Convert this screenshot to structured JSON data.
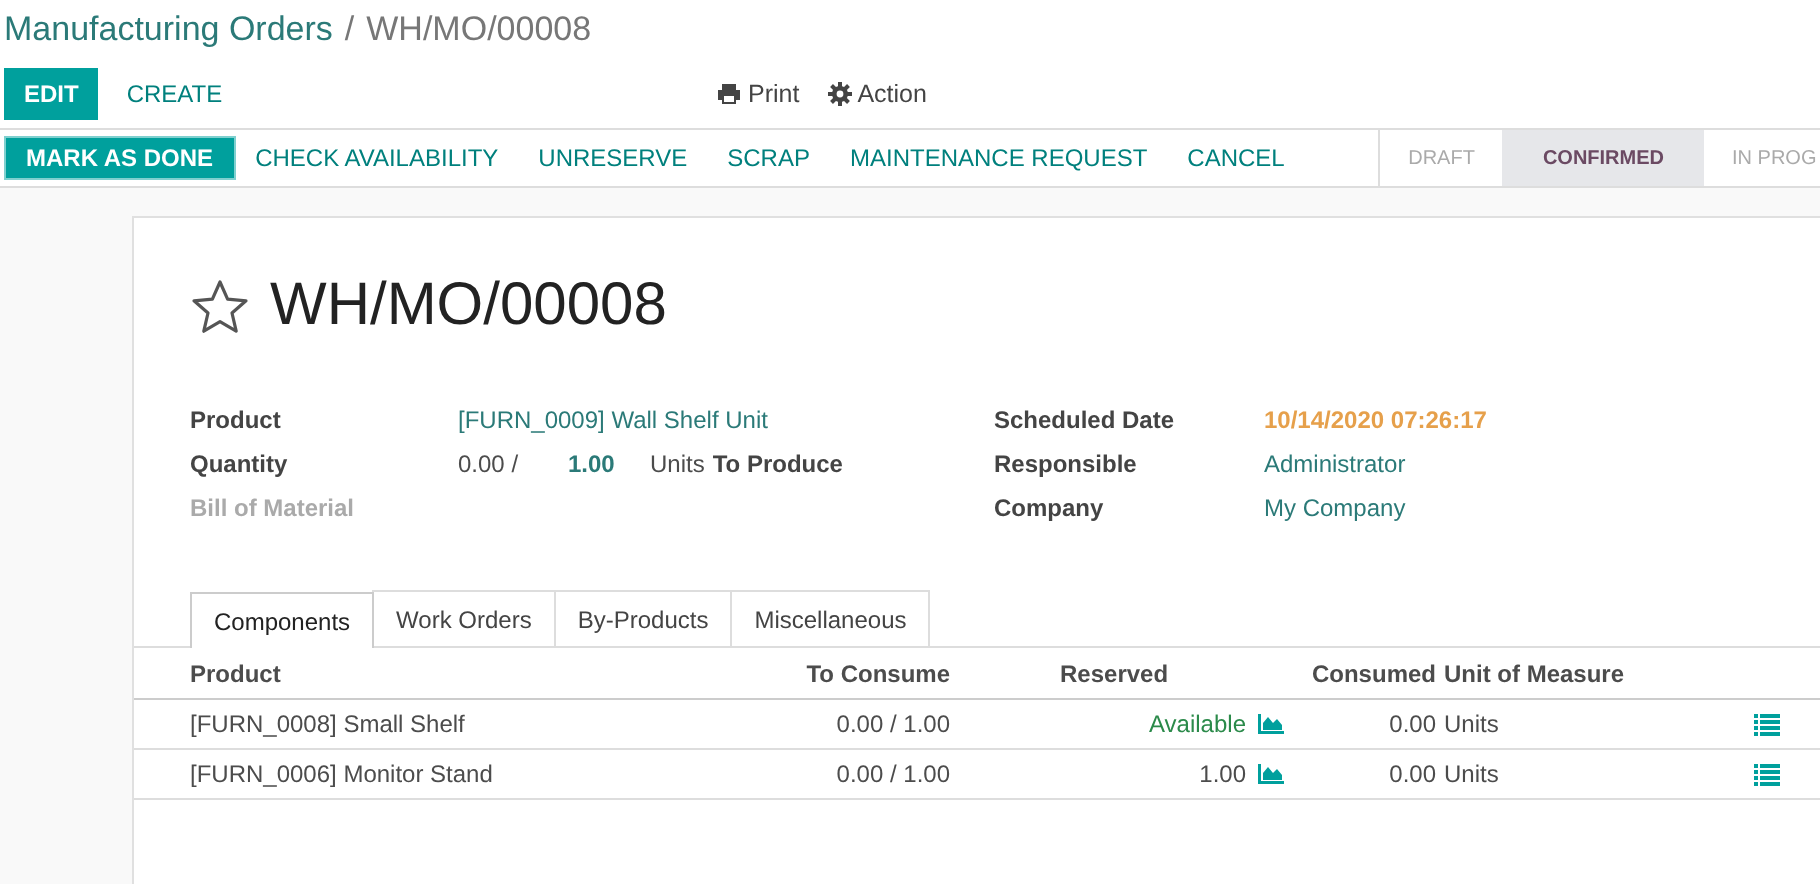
{
  "breadcrumb": {
    "parent": "Manufacturing Orders",
    "separator": "/",
    "current": "WH/MO/00008"
  },
  "buttons": [
    {
      "label": "EDIT",
      "kind": "primary"
    },
    {
      "label": "CREATE",
      "kind": "link"
    }
  ],
  "actions": [
    {
      "label": "Print",
      "kind": "print"
    },
    {
      "label": "Action",
      "kind": "gear"
    }
  ],
  "statusbar_buttons": [
    {
      "label": "MARK AS DONE",
      "kind": "primary"
    },
    {
      "label": "CHECK AVAILABILITY",
      "kind": "link"
    },
    {
      "label": "UNRESERVE",
      "kind": "link"
    },
    {
      "label": "SCRAP",
      "kind": "link"
    },
    {
      "label": "MAINTENANCE REQUEST",
      "kind": "link"
    },
    {
      "label": "CANCEL",
      "kind": "link"
    }
  ],
  "stages": [
    {
      "label": "DRAFT",
      "selected": false
    },
    {
      "label": "CONFIRMED",
      "selected": true
    },
    {
      "label": "IN PROG",
      "selected": false
    }
  ],
  "record": {
    "title": "WH/MO/00008",
    "starred": false
  },
  "left_fields": [
    {
      "label": "Product",
      "value": "[FURN_0009] Wall Shelf Unit",
      "kind": "link",
      "disabled": false
    },
    {
      "label": "Quantity",
      "kind": "quantity",
      "disabled": false,
      "done": "0.00 /",
      "qty": "1.00",
      "uom": "Units",
      "suffix": "To Produce"
    },
    {
      "label": "Bill of Material",
      "kind": "empty",
      "disabled": true
    }
  ],
  "right_fields": [
    {
      "label": "Scheduled Date",
      "value": "10/14/2020 07:26:17",
      "kind": "warning"
    },
    {
      "label": "Responsible",
      "value": "Administrator",
      "kind": "link"
    },
    {
      "label": "Company",
      "value": "My Company",
      "kind": "link"
    }
  ],
  "tabs": [
    {
      "label": "Components",
      "selected": true
    },
    {
      "label": "Work Orders",
      "selected": false
    },
    {
      "label": "By-Products",
      "selected": false
    },
    {
      "label": "Miscellaneous",
      "selected": false
    }
  ],
  "table": {
    "columns": [
      "Product",
      "To Consume",
      "Reserved",
      "Consumed",
      "Unit of Measure"
    ],
    "rows": [
      {
        "product": "[FURN_0008] Small Shelf",
        "to_consume": "0.00 / 1.00",
        "reserved": "Available",
        "available": true,
        "consumed": "0.00",
        "uom": "Units"
      },
      {
        "product": "[FURN_0006] Monitor Stand",
        "to_consume": "0.00 / 1.00",
        "reserved": "1.00",
        "available": false,
        "consumed": "0.00",
        "uom": "Units"
      }
    ]
  }
}
